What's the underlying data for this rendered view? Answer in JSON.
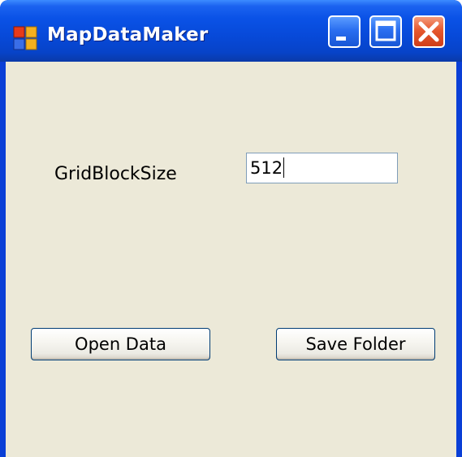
{
  "window": {
    "title": "MapDataMaker",
    "caption_buttons": {
      "minimize": "minimize-icon",
      "maximize": "maximize-icon",
      "close": "close-icon"
    }
  },
  "form": {
    "grid_block_size_label": "GridBlockSize",
    "grid_block_size_value": "512"
  },
  "buttons": {
    "open_data_label": "Open Data",
    "save_folder_label": "Save Folder"
  },
  "colors": {
    "titlebar_blue": "#0a52e6",
    "client_background": "#ece9d8",
    "close_red": "#e6582e"
  }
}
